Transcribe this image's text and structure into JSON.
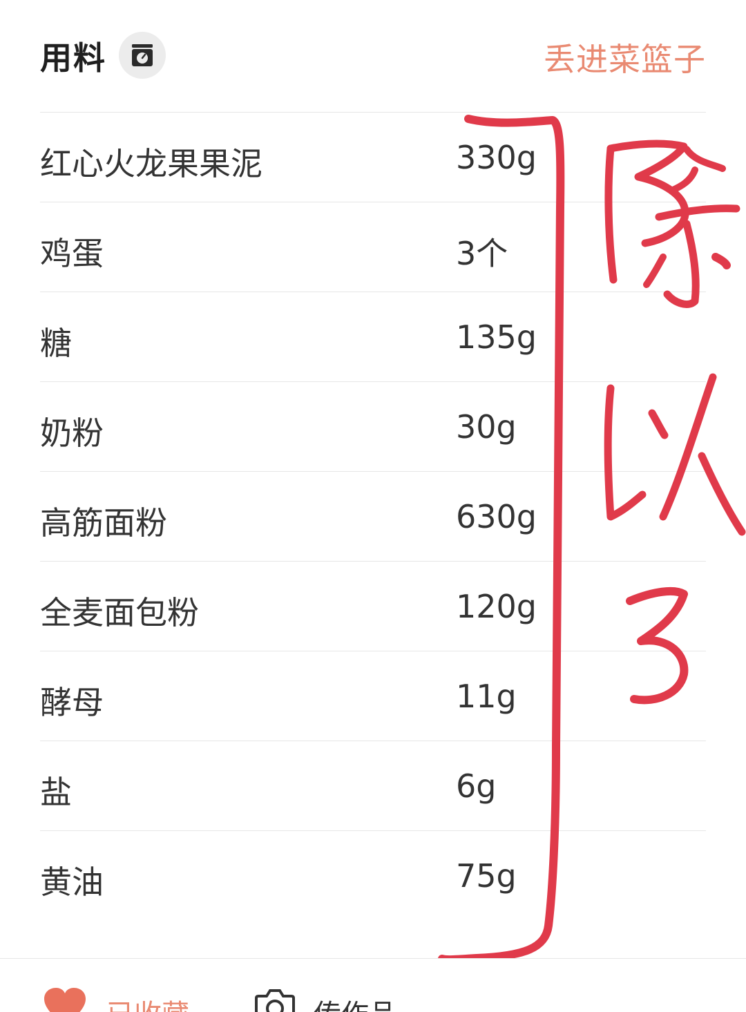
{
  "header": {
    "title": "用料",
    "scale_icon": "kitchen-scale-icon",
    "basket_link": "丢进菜篮子"
  },
  "ingredients": [
    {
      "name": "红心火龙果果泥",
      "amount": "330g"
    },
    {
      "name": "鸡蛋",
      "amount": "3个"
    },
    {
      "name": "糖",
      "amount": "135g"
    },
    {
      "name": "奶粉",
      "amount": "30g"
    },
    {
      "name": "高筋面粉",
      "amount": "630g"
    },
    {
      "name": "全麦面包粉",
      "amount": "120g"
    },
    {
      "name": "酵母",
      "amount": "11g"
    },
    {
      "name": "盐",
      "amount": "6g"
    },
    {
      "name": "黄油",
      "amount": "75g"
    }
  ],
  "annotation": {
    "handwritten_text": "除以3",
    "color": "#e03a4a"
  },
  "bottom_bar": {
    "favorite_label": "已收藏",
    "favorite_icon": "heart-icon",
    "upload_label": "传作品",
    "upload_icon": "camera-icon"
  },
  "colors": {
    "accent": "#e98a72",
    "text": "#333333",
    "divider": "#e6e6e6"
  }
}
